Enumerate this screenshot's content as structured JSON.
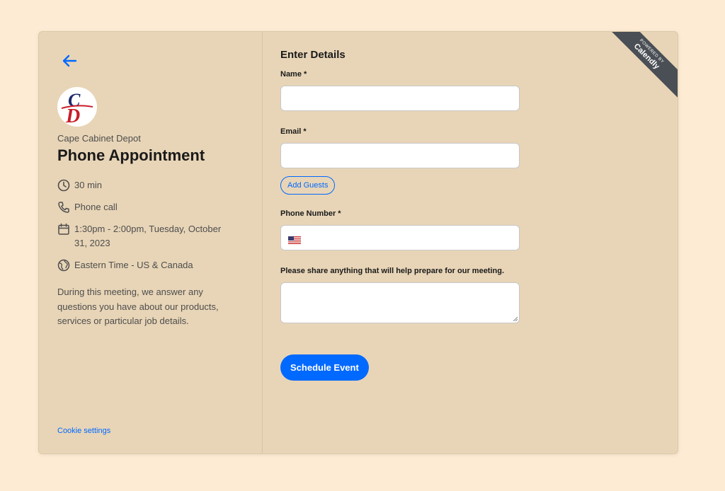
{
  "sidebar": {
    "org_name": "Cape Cabinet Depot",
    "event_title": "Phone Appointment",
    "details": {
      "duration": "30 min",
      "location": "Phone call",
      "datetime_line1": "1:30pm - 2:00pm, Tuesday, October",
      "datetime_line2": "31, 2023",
      "timezone": "Eastern Time - US & Canada"
    },
    "description": "During this meeting, we answer any questions you have about our products, services or particular job details.",
    "cookie_link": "Cookie settings",
    "logo_letters": [
      "C",
      "D"
    ]
  },
  "form": {
    "title": "Enter Details",
    "name_label": "Name *",
    "email_label": "Email *",
    "add_guests_label": "Add Guests",
    "phone_label": "Phone Number *",
    "notes_label": "Please share anything that will help prepare for our meeting.",
    "submit_label": "Schedule Event",
    "name_value": "",
    "email_value": "",
    "phone_value": "",
    "notes_value": ""
  },
  "badge": {
    "small": "POWERED BY",
    "big": "Calendly"
  },
  "colors": {
    "page_bg": "#fdebd4",
    "card_bg": "#e8d5b7",
    "accent": "#0069ff",
    "ribbon": "#4a4f55",
    "logo_red": "#c81e28",
    "logo_navy": "#1c2a6b"
  },
  "icons": [
    "arrow-left-icon",
    "clock-icon",
    "phone-icon",
    "calendar-icon",
    "globe-icon",
    "us-flag-icon"
  ]
}
